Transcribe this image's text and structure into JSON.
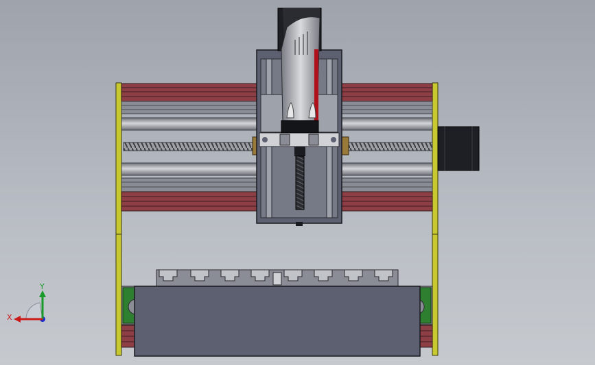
{
  "viewport": {
    "background": "#b4b8c0"
  },
  "triad": {
    "x_label": "X",
    "y_label": "Y",
    "x_color": "#cc1a1a",
    "y_color": "#1a9a2a",
    "z_color": "#1a2acc"
  },
  "colors": {
    "frame_yellow": "#c4c426",
    "rail_red": "#8e3f46",
    "rail_grey": "#8a8d95",
    "body_grey": "#5d6070",
    "motor_black": "#1e1f24",
    "bearing_green": "#2f7f30",
    "spindle_red": "#b0101a"
  }
}
